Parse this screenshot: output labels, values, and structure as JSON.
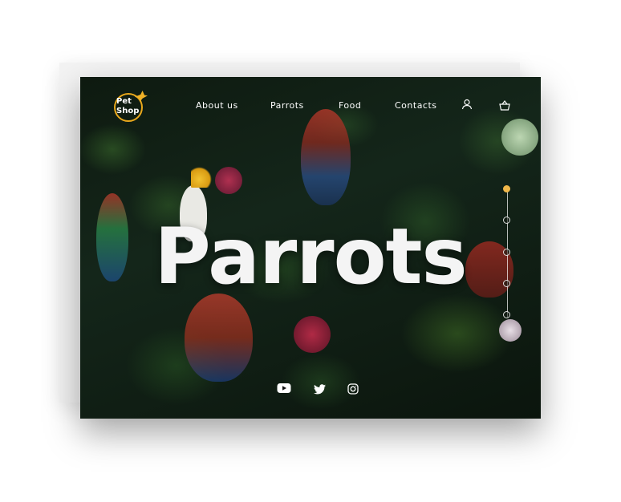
{
  "brand": {
    "line1": "Pet",
    "line2": "Shop",
    "accent_color": "#e9a81c"
  },
  "nav": {
    "items": [
      "About us",
      "Parrots",
      "Food",
      "Contacts"
    ]
  },
  "header_icons": [
    "user-icon",
    "basket-icon"
  ],
  "hero": {
    "title": "Parrots"
  },
  "pager": {
    "count": 5,
    "active_index": 0,
    "active_color": "#f0b84a"
  },
  "social": [
    "youtube-icon",
    "twitter-icon",
    "instagram-icon"
  ]
}
